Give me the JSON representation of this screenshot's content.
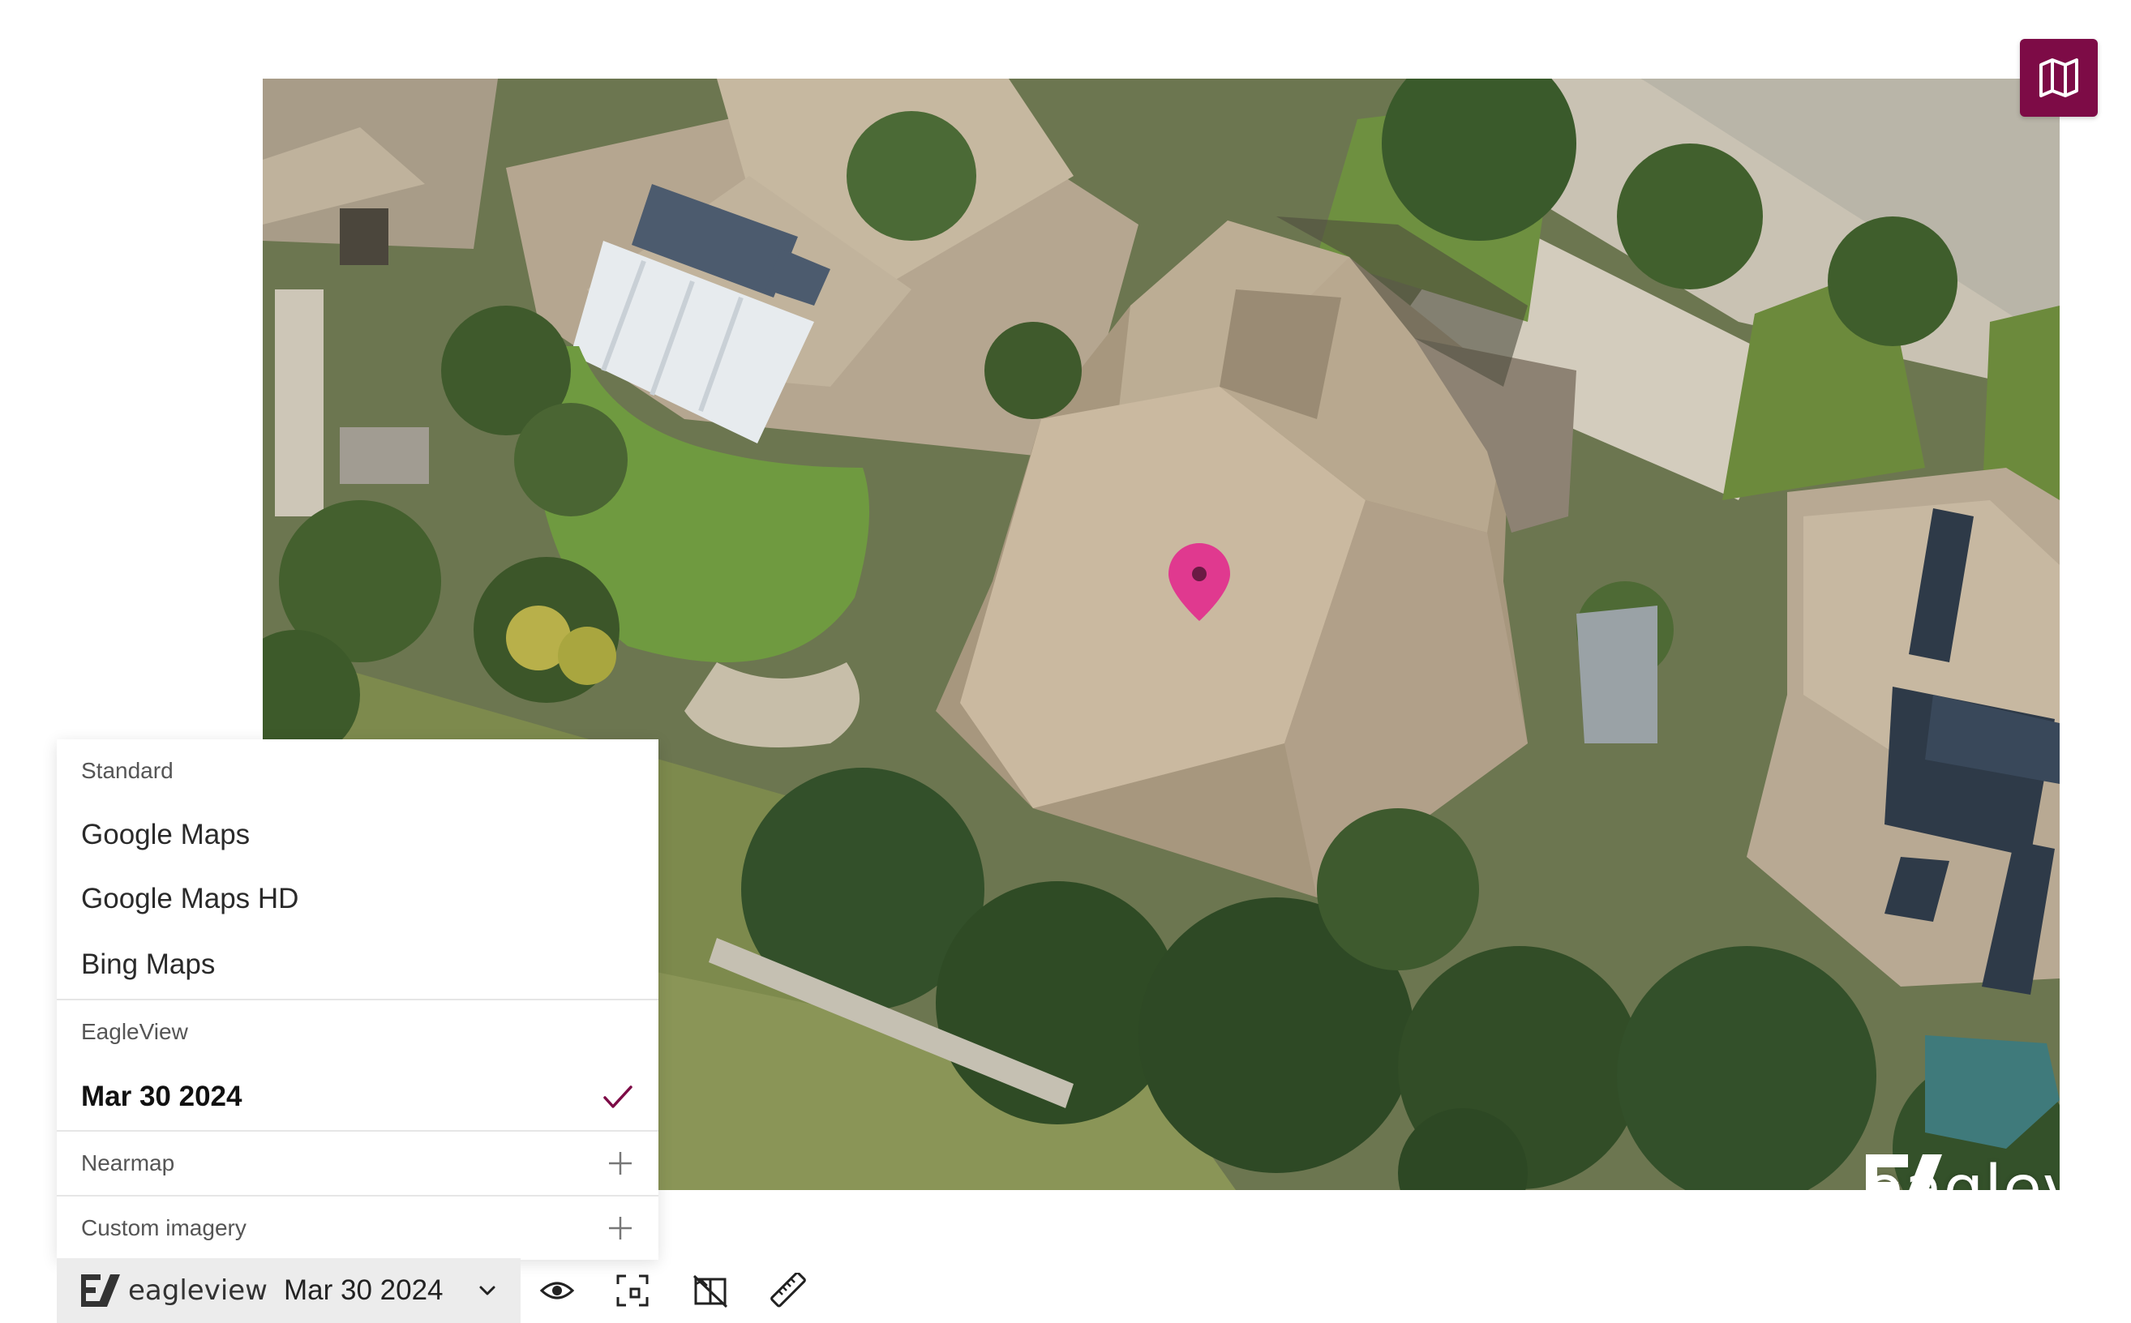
{
  "imagery_menu": {
    "standard": {
      "header": "Standard",
      "options": [
        "Google Maps",
        "Google Maps HD",
        "Bing Maps"
      ]
    },
    "eagleview": {
      "header": "EagleView",
      "selected_option": "Mar 30 2024"
    },
    "nearmap": {
      "header": "Nearmap"
    },
    "custom": {
      "header": "Custom imagery"
    }
  },
  "toolbar": {
    "source_name": "eagleview",
    "source_date": "Mar 30 2024",
    "icons": [
      "eye-icon",
      "crop-frame-icon",
      "compare-map-icon",
      "ruler-icon"
    ]
  },
  "map": {
    "watermark_text": "eagleview",
    "watermark_reg": "®",
    "pin_color": "#e0398f",
    "toggle_color": "#7d0b46",
    "toggle_icon": "map-icon"
  }
}
